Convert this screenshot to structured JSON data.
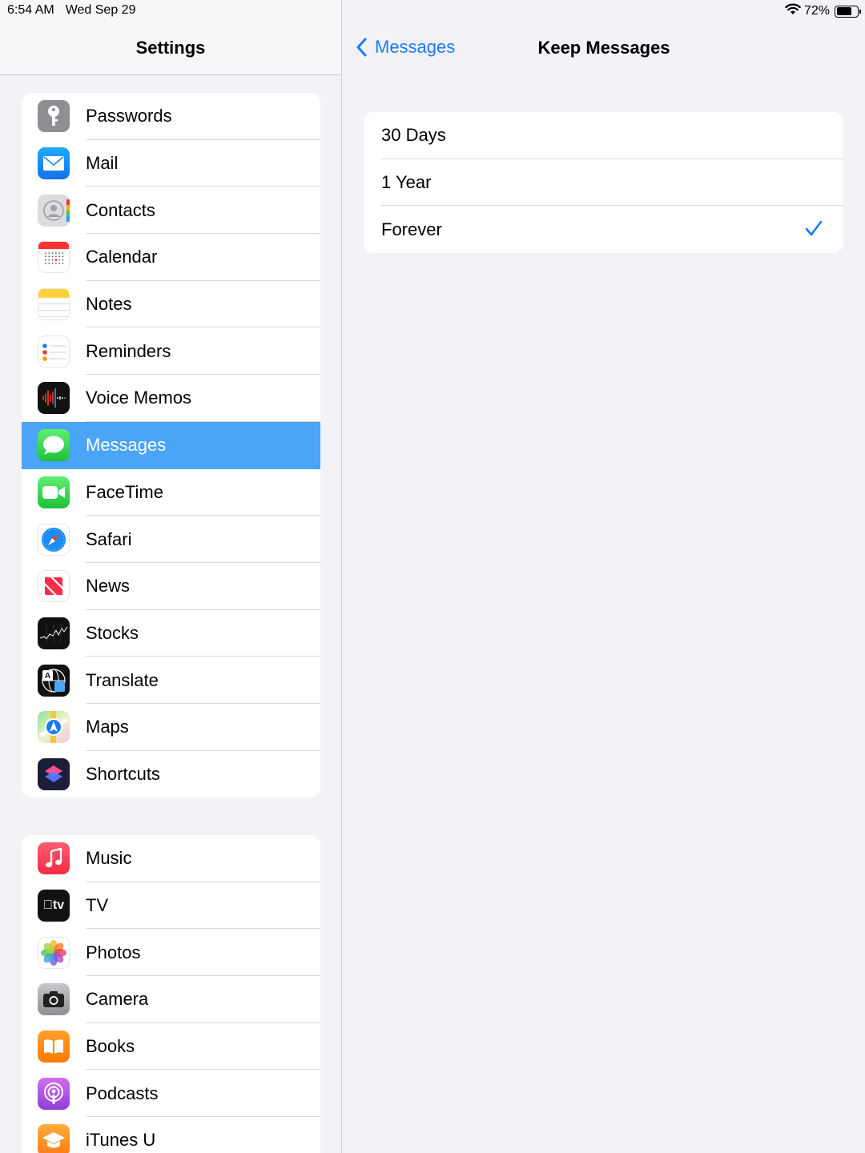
{
  "status": {
    "time": "6:54 AM",
    "date": "Wed Sep 29",
    "battery_percent": "72%",
    "battery_level": 0.72
  },
  "sidebar": {
    "title": "Settings",
    "group1": [
      {
        "label": "Passwords",
        "icon": "key-icon"
      },
      {
        "label": "Mail",
        "icon": "mail-icon"
      },
      {
        "label": "Contacts",
        "icon": "contacts-icon"
      },
      {
        "label": "Calendar",
        "icon": "calendar-icon"
      },
      {
        "label": "Notes",
        "icon": "notes-icon"
      },
      {
        "label": "Reminders",
        "icon": "reminders-icon"
      },
      {
        "label": "Voice Memos",
        "icon": "voice-memos-icon"
      },
      {
        "label": "Messages",
        "icon": "messages-icon",
        "selected": true
      },
      {
        "label": "FaceTime",
        "icon": "facetime-icon"
      },
      {
        "label": "Safari",
        "icon": "safari-icon"
      },
      {
        "label": "News",
        "icon": "news-icon"
      },
      {
        "label": "Stocks",
        "icon": "stocks-icon"
      },
      {
        "label": "Translate",
        "icon": "translate-icon"
      },
      {
        "label": "Maps",
        "icon": "maps-icon"
      },
      {
        "label": "Shortcuts",
        "icon": "shortcuts-icon"
      }
    ],
    "group2": [
      {
        "label": "Music",
        "icon": "music-icon"
      },
      {
        "label": "TV",
        "icon": "tv-icon"
      },
      {
        "label": "Photos",
        "icon": "photos-icon"
      },
      {
        "label": "Camera",
        "icon": "camera-icon"
      },
      {
        "label": "Books",
        "icon": "books-icon"
      },
      {
        "label": "Podcasts",
        "icon": "podcasts-icon"
      },
      {
        "label": "iTunes U",
        "icon": "itunes-u-icon"
      }
    ]
  },
  "detail": {
    "back_label": "Messages",
    "title": "Keep Messages",
    "options": [
      {
        "label": "30 Days",
        "checked": false
      },
      {
        "label": "1 Year",
        "checked": false
      },
      {
        "label": "Forever",
        "checked": true
      }
    ]
  },
  "colors": {
    "accent": "#1a7cf5",
    "selected_row": "#4aa4f7",
    "background": "#f2f2f7"
  }
}
